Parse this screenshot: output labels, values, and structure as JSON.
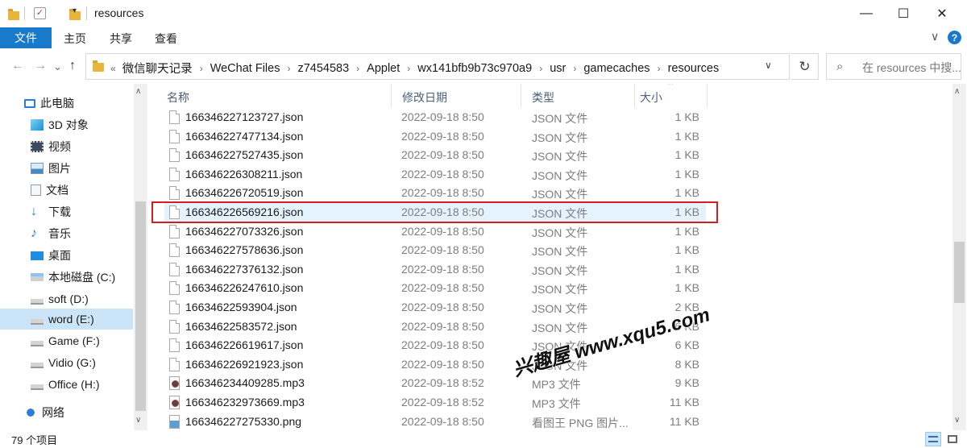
{
  "window": {
    "title": "resources",
    "minimize": "—",
    "maximize": "☐",
    "close": "✕"
  },
  "ribbon": {
    "tabs": [
      "文件",
      "主页",
      "共享",
      "查看"
    ],
    "collapse_glyph": "∨",
    "help_glyph": "?"
  },
  "nav": {
    "back": "←",
    "forward": "→",
    "recent": "⌄",
    "up": "↑"
  },
  "address": {
    "overflow": "«",
    "crumbs": [
      "微信聊天记录",
      "WeChat Files",
      "z7454583",
      "Applet",
      "wx141bfb9b73c970a9",
      "usr",
      "gamecaches",
      "resources"
    ],
    "separator": "›",
    "dropdown": "∨",
    "refresh": "↻"
  },
  "search": {
    "placeholder": "在 resources 中搜...",
    "icon": "search-icon"
  },
  "sidebar": {
    "items": [
      {
        "label": "此电脑",
        "icon": "computer-icon"
      },
      {
        "label": "3D 对象",
        "icon": "cube-icon"
      },
      {
        "label": "视频",
        "icon": "video-icon"
      },
      {
        "label": "图片",
        "icon": "picture-icon"
      },
      {
        "label": "文档",
        "icon": "document-icon"
      },
      {
        "label": "下载",
        "icon": "download-icon"
      },
      {
        "label": "音乐",
        "icon": "music-icon"
      },
      {
        "label": "桌面",
        "icon": "desktop-icon"
      },
      {
        "label": "本地磁盘 (C:)",
        "icon": "system-drive-icon"
      },
      {
        "label": "soft (D:)",
        "icon": "drive-icon"
      },
      {
        "label": "word (E:)",
        "icon": "drive-icon",
        "selected": true
      },
      {
        "label": "Game (F:)",
        "icon": "drive-icon"
      },
      {
        "label": "Vidio (G:)",
        "icon": "drive-icon"
      },
      {
        "label": "Office (H:)",
        "icon": "drive-icon"
      },
      {
        "label": "网络",
        "icon": "network-icon"
      }
    ]
  },
  "columns": {
    "name": "名称",
    "date": "修改日期",
    "type": "类型",
    "size": "大小",
    "sort_glyph": "^"
  },
  "files": [
    {
      "name": "166346227123727.json",
      "date": "2022-09-18 8:50",
      "type": "JSON 文件",
      "size": "1 KB",
      "kind": "json"
    },
    {
      "name": "166346227477134.json",
      "date": "2022-09-18 8:50",
      "type": "JSON 文件",
      "size": "1 KB",
      "kind": "json"
    },
    {
      "name": "166346227527435.json",
      "date": "2022-09-18 8:50",
      "type": "JSON 文件",
      "size": "1 KB",
      "kind": "json"
    },
    {
      "name": "166346226308211.json",
      "date": "2022-09-18 8:50",
      "type": "JSON 文件",
      "size": "1 KB",
      "kind": "json"
    },
    {
      "name": "166346226720519.json",
      "date": "2022-09-18 8:50",
      "type": "JSON 文件",
      "size": "1 KB",
      "kind": "json"
    },
    {
      "name": "166346226569216.json",
      "date": "2022-09-18 8:50",
      "type": "JSON 文件",
      "size": "1 KB",
      "kind": "json",
      "selected": true
    },
    {
      "name": "166346227073326.json",
      "date": "2022-09-18 8:50",
      "type": "JSON 文件",
      "size": "1 KB",
      "kind": "json"
    },
    {
      "name": "166346227578636.json",
      "date": "2022-09-18 8:50",
      "type": "JSON 文件",
      "size": "1 KB",
      "kind": "json"
    },
    {
      "name": "166346227376132.json",
      "date": "2022-09-18 8:50",
      "type": "JSON 文件",
      "size": "1 KB",
      "kind": "json"
    },
    {
      "name": "166346226247610.json",
      "date": "2022-09-18 8:50",
      "type": "JSON 文件",
      "size": "1 KB",
      "kind": "json"
    },
    {
      "name": "16634622593904.json",
      "date": "2022-09-18 8:50",
      "type": "JSON 文件",
      "size": "2 KB",
      "kind": "json"
    },
    {
      "name": "16634622583572.json",
      "date": "2022-09-18 8:50",
      "type": "JSON 文件",
      "size": "6 KB",
      "kind": "json"
    },
    {
      "name": "166346226619617.json",
      "date": "2022-09-18 8:50",
      "type": "JSON 文件",
      "size": "6 KB",
      "kind": "json"
    },
    {
      "name": "166346226921923.json",
      "date": "2022-09-18 8:50",
      "type": "JSON 文件",
      "size": "8 KB",
      "kind": "json"
    },
    {
      "name": "166346234409285.mp3",
      "date": "2022-09-18 8:52",
      "type": "MP3 文件",
      "size": "9 KB",
      "kind": "mp3"
    },
    {
      "name": "166346232973669.mp3",
      "date": "2022-09-18 8:52",
      "type": "MP3 文件",
      "size": "11 KB",
      "kind": "mp3"
    },
    {
      "name": "166346227275330.png",
      "date": "2022-09-18 8:50",
      "type": "看图王 PNG 图片...",
      "size": "11 KB",
      "kind": "png"
    }
  ],
  "watermark": "兴趣屋 www.xqu5.com",
  "status": {
    "count": "79 个项目"
  },
  "colors": {
    "accent": "#1979ca",
    "selection": "#cce4f7",
    "highlight_border": "#d41e1e"
  }
}
